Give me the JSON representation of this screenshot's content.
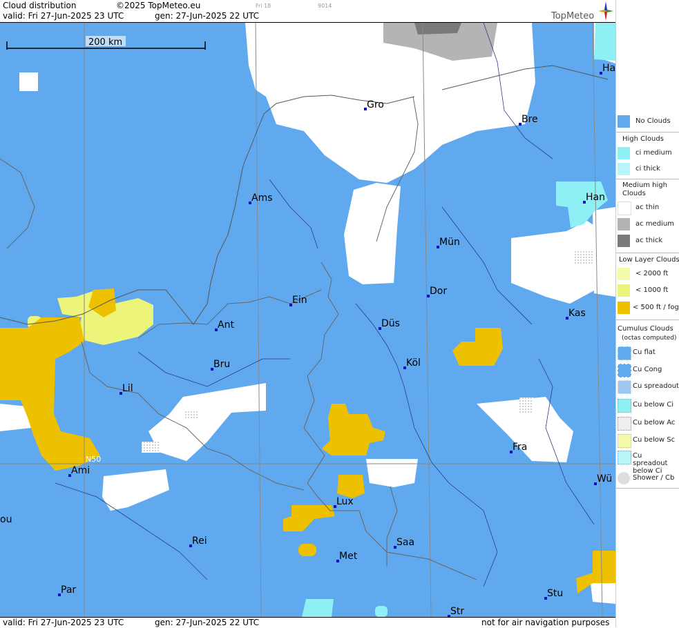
{
  "header": {
    "title": "Cloud distribution",
    "copyright": "©2025 TopMeteo.eu",
    "day_tag": "Fri 18",
    "code_tag": "9014",
    "valid": "valid:  Fri  27-Jun-2025  23 UTC",
    "gen": "gen: 27-Jun-2025 22 UTC",
    "logo": "TopMeteo"
  },
  "scale_label": "200 km",
  "grid_label": "N50",
  "footer": {
    "valid": "valid:  Fri  27-Jun-2025  23 UTC",
    "gen": "gen: 27-Jun-2025 22 UTC",
    "notice": "not for air navigation purposes"
  },
  "colors": {
    "no_clouds": "#60a9ef",
    "high_ci": "#8ef0f4",
    "medium_white": "#ffffff",
    "ac_medium": "#b4b4b4",
    "ac_thick": "#7a7a7a",
    "low_2000": "#f4fba8",
    "low_1000": "#ecf47a",
    "low_500": "#eec100"
  },
  "cities": [
    {
      "name": "Gro"
    },
    {
      "name": "Bre"
    },
    {
      "name": "Ha"
    },
    {
      "name": "Ams"
    },
    {
      "name": "Han"
    },
    {
      "name": "Mün"
    },
    {
      "name": "Dor"
    },
    {
      "name": "Ein"
    },
    {
      "name": "Kas"
    },
    {
      "name": "Ant"
    },
    {
      "name": "Düs"
    },
    {
      "name": "Köl"
    },
    {
      "name": "Bru"
    },
    {
      "name": "Lil"
    },
    {
      "name": "Fra"
    },
    {
      "name": "Ami"
    },
    {
      "name": "Lux"
    },
    {
      "name": "Wü"
    },
    {
      "name": "ou"
    },
    {
      "name": "Rei"
    },
    {
      "name": "Saa"
    },
    {
      "name": "Met"
    },
    {
      "name": "Par"
    },
    {
      "name": "Stu"
    },
    {
      "name": "Str"
    }
  ],
  "legend": {
    "no_clouds": "No Clouds",
    "high_title": "High Clouds",
    "ci_medium": "ci medium",
    "ci_thick": "ci thick",
    "medium_title": "Medium high Clouds",
    "ac_thin": "ac thin",
    "ac_medium": "ac medium",
    "ac_thick": "ac thick",
    "low_title": "Low Layer Clouds",
    "low_2000": "< 2000 ft",
    "low_1000": "< 1000 ft",
    "low_500": "< 500 ft / fog",
    "cu_title": "Cumulus Clouds",
    "cu_sub": "(octas computed)",
    "cu_flat": "Cu flat",
    "cu_cong": "Cu Cong",
    "cu_spread": "Cu spreadout",
    "cu_below_ci": "Cu below Ci",
    "cu_below_ac": "Cu below Ac",
    "cu_below_sc": "Cu below Sc",
    "cu_spread_ci": "Cu spreadout below Ci",
    "shower": "Shower / Cb"
  }
}
